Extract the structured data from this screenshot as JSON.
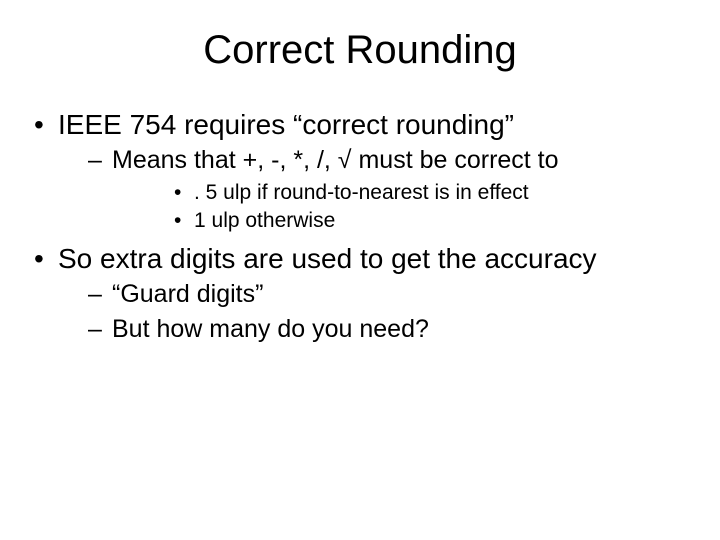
{
  "title": "Correct Rounding",
  "bullets": [
    {
      "text": "IEEE 754 requires “correct rounding”",
      "sub": [
        {
          "text": "Means that +, -, *, /, √ must be correct to",
          "sub": [
            {
              "text": ". 5 ulp if round-to-nearest is in effect"
            },
            {
              "text": "1 ulp otherwise"
            }
          ]
        }
      ]
    },
    {
      "text": "So extra digits are used to get the accuracy",
      "sub": [
        {
          "text": "“Guard digits”"
        },
        {
          "text": "But how many do you need?"
        }
      ]
    }
  ]
}
